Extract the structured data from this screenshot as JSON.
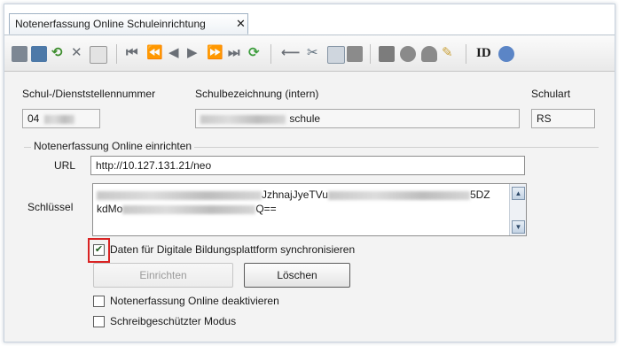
{
  "tab": {
    "title": "Notenerfassung Online Schuleinrichtung",
    "close": "✕"
  },
  "toolbar": {
    "icons": [
      "new-record-icon",
      "save-icon",
      "undo-icon",
      "delete-icon",
      "properties-icon",
      "first-icon",
      "previous-page-icon",
      "previous-icon",
      "next-icon",
      "next-page-icon",
      "last-icon",
      "refresh-icon",
      "back-arrow-icon",
      "cut-icon",
      "copy-icon",
      "paste-icon",
      "print-icon",
      "print-preview-icon",
      "pin-icon",
      "clear-icon",
      "id-icon",
      "help-icon"
    ],
    "id_label": "ID"
  },
  "school": {
    "number_label": "Schul-/Dienststellennummer",
    "number_value": "04",
    "name_label": "Schulbezeichnung (intern)",
    "name_value": "schule",
    "type_label": "Schulart",
    "type_value": "RS"
  },
  "setup": {
    "group_title": "Notenerfassung Online einrichten",
    "url_label": "URL",
    "url_value": "http://10.127.131.21/neo",
    "key_label": "Schlüssel",
    "key_line1_visible": "JzhnajJyeTVu",
    "key_line1_end": "5DZ",
    "key_line2_start": "kdMo",
    "key_line2_end": "Q=="
  },
  "options": {
    "sync_label": "Daten für Digitale Bildungsplattform synchronisieren",
    "sync_checked": true,
    "setup_button": "Einrichten",
    "delete_button": "Löschen",
    "deactivate_label": "Notenerfassung Online deaktivieren",
    "deactivate_checked": false,
    "readonly_label": "Schreibgeschützter Modus",
    "readonly_checked": false
  },
  "colors": {
    "highlight": "#d92323",
    "check": "#1d5c1d"
  }
}
